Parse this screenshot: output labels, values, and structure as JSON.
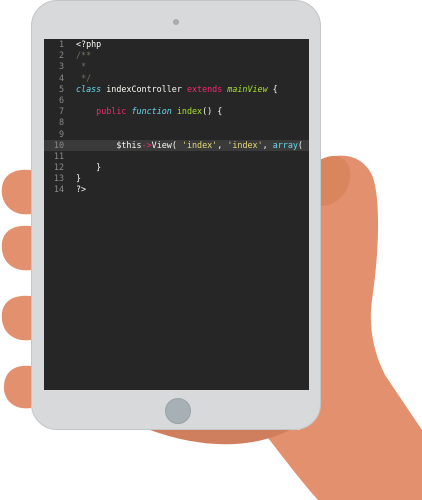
{
  "editor": {
    "language": "php",
    "active_line": 10,
    "colors": {
      "background": "#262626",
      "active_line": "#3a3a3a",
      "line_number": "#8a8a8a",
      "plain": "#f8f8f2",
      "comment": "#75715e",
      "keyword": "#66d9ef",
      "magenta": "#f92672",
      "green": "#a6e22e",
      "string": "#e6db74"
    },
    "lines": [
      {
        "num": "1",
        "tokens": [
          {
            "t": "<?php",
            "c": "plain"
          }
        ]
      },
      {
        "num": "2",
        "tokens": [
          {
            "t": "/**",
            "c": "comment"
          }
        ]
      },
      {
        "num": "3",
        "tokens": [
          {
            "t": " *",
            "c": "comment"
          }
        ]
      },
      {
        "num": "4",
        "tokens": [
          {
            "t": " */",
            "c": "comment"
          }
        ]
      },
      {
        "num": "5",
        "tokens": [
          {
            "t": "class",
            "c": "keyword"
          },
          {
            "t": " indexController ",
            "c": "plain"
          },
          {
            "t": "extends",
            "c": "extends"
          },
          {
            "t": " ",
            "c": "plain"
          },
          {
            "t": "mainView",
            "c": "class"
          },
          {
            "t": " {",
            "c": "plain"
          }
        ]
      },
      {
        "num": "6",
        "tokens": []
      },
      {
        "num": "7",
        "tokens": [
          {
            "t": "    ",
            "c": "plain"
          },
          {
            "t": "public",
            "c": "public"
          },
          {
            "t": " ",
            "c": "plain"
          },
          {
            "t": "function",
            "c": "keyword"
          },
          {
            "t": " ",
            "c": "plain"
          },
          {
            "t": "index",
            "c": "function-name"
          },
          {
            "t": "() {",
            "c": "plain"
          }
        ]
      },
      {
        "num": "8",
        "tokens": []
      },
      {
        "num": "9",
        "tokens": []
      },
      {
        "num": "10",
        "tokens": [
          {
            "t": "        $this",
            "c": "plain"
          },
          {
            "t": "->",
            "c": "operator"
          },
          {
            "t": "View",
            "c": "plain"
          },
          {
            "t": "( ",
            "c": "plain"
          },
          {
            "t": "'index'",
            "c": "string"
          },
          {
            "t": ", ",
            "c": "plain"
          },
          {
            "t": "'index'",
            "c": "string"
          },
          {
            "t": ", ",
            "c": "plain"
          },
          {
            "t": "array",
            "c": "builtin"
          },
          {
            "t": "(",
            "c": "plain"
          }
        ]
      },
      {
        "num": "11",
        "tokens": []
      },
      {
        "num": "12",
        "tokens": [
          {
            "t": "    }",
            "c": "plain"
          }
        ]
      },
      {
        "num": "13",
        "tokens": [
          {
            "t": "}",
            "c": "plain"
          }
        ]
      },
      {
        "num": "14",
        "tokens": [
          {
            "t": "?>",
            "c": "plain"
          }
        ]
      }
    ]
  },
  "device": {
    "body_color": "#d7d9db",
    "home_button_color": "#a6b0b5",
    "skin_color": "#e2906e",
    "skin_shadow_color": "#d07f5e"
  }
}
